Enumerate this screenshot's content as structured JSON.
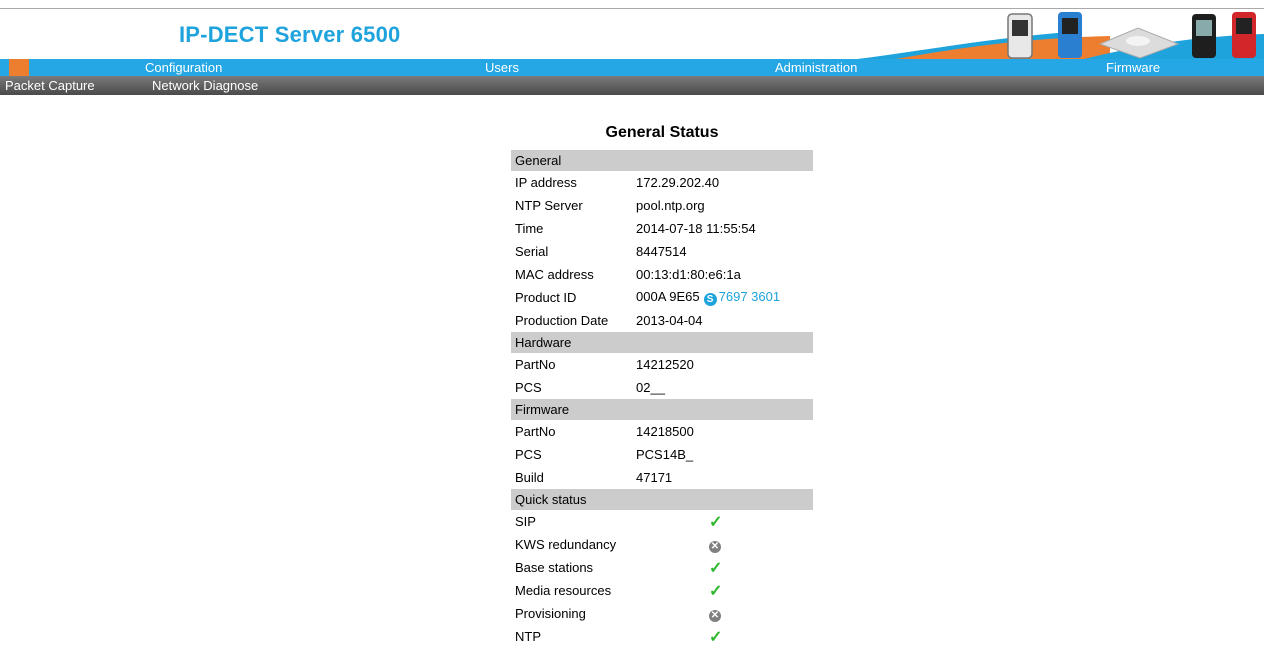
{
  "header": {
    "title": "IP-DECT Server 6500"
  },
  "nav": {
    "items": [
      "Configuration",
      "Users",
      "Administration",
      "Firmware"
    ]
  },
  "subnav": {
    "items": [
      "Packet Capture",
      "Network Diagnose"
    ]
  },
  "status": {
    "title": "General Status",
    "general": {
      "heading": "General",
      "rows": [
        {
          "label": "IP address",
          "value": "172.29.202.40"
        },
        {
          "label": "NTP Server",
          "value": "pool.ntp.org"
        },
        {
          "label": "Time",
          "value": "2014-07-18 11:55:54"
        },
        {
          "label": "Serial",
          "value": "8447514"
        },
        {
          "label": "MAC address",
          "value": "00:13:d1:80:e6:1a"
        },
        {
          "label": "Product ID",
          "value": "000A 9E65",
          "link": "7697 3601"
        },
        {
          "label": "Production Date",
          "value": "2013-04-04"
        }
      ]
    },
    "hardware": {
      "heading": "Hardware",
      "rows": [
        {
          "label": "PartNo",
          "value": "14212520"
        },
        {
          "label": "PCS",
          "value": "02__"
        }
      ]
    },
    "firmware": {
      "heading": "Firmware",
      "rows": [
        {
          "label": "PartNo",
          "value": "14218500"
        },
        {
          "label": "PCS",
          "value": "PCS14B_"
        },
        {
          "label": "Build",
          "value": "47171"
        }
      ]
    },
    "quick": {
      "heading": "Quick status",
      "rows": [
        {
          "label": "SIP",
          "icon": "check-icon",
          "state": "ok"
        },
        {
          "label": "KWS redundancy",
          "icon": "x-circle-icon",
          "state": "off"
        },
        {
          "label": "Base stations",
          "icon": "check-icon",
          "state": "ok"
        },
        {
          "label": "Media resources",
          "icon": "check-icon",
          "state": "ok"
        },
        {
          "label": "Provisioning",
          "icon": "x-circle-icon",
          "state": "off"
        },
        {
          "label": "NTP",
          "icon": "check-icon",
          "state": "ok"
        }
      ]
    }
  },
  "colors": {
    "accent": "#1ea3dc",
    "nav": "#25a7e5",
    "orange": "#ee7e2f",
    "ok": "#2eb82e",
    "off": "#808080"
  }
}
